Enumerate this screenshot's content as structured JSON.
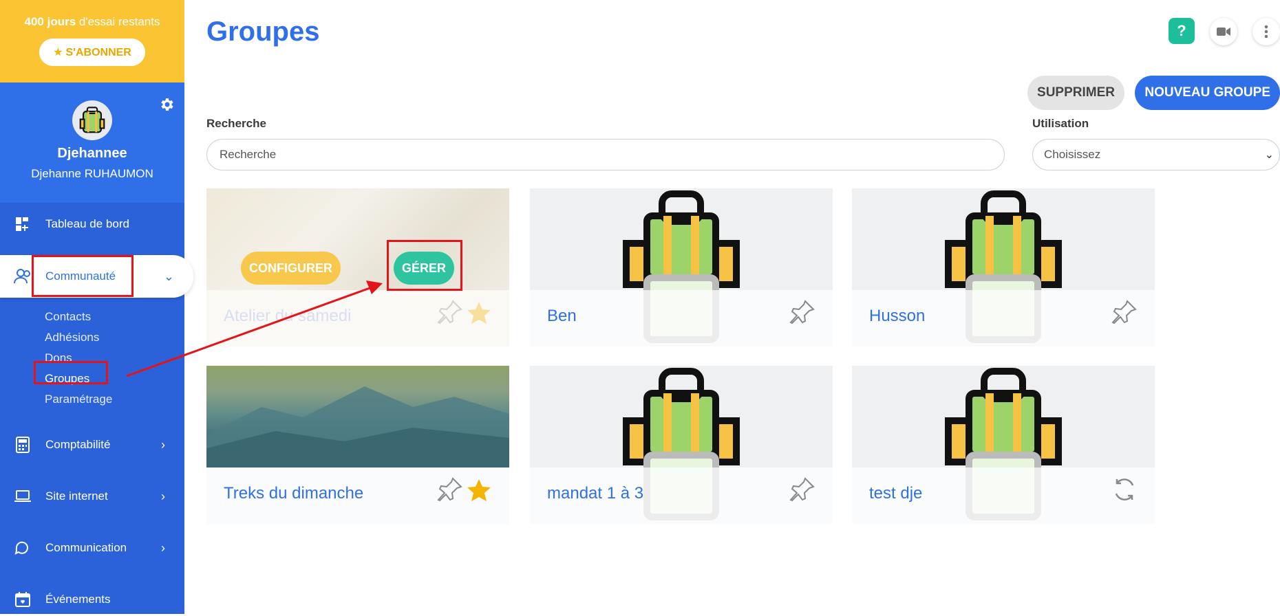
{
  "trial": {
    "days": "400 jours",
    "rest": " d'essai restants",
    "subscribe": "S'ABONNER"
  },
  "profile": {
    "name": "Djehannee",
    "fullname": "Djehanne RUHAUMON"
  },
  "menu": {
    "dashboard": "Tableau de bord",
    "community": "Communauté",
    "accounting": "Comptabilité",
    "website": "Site internet",
    "communication": "Communication",
    "events": "Événements"
  },
  "community_sub": [
    "Contacts",
    "Adhésions",
    "Dons",
    "Groupes",
    "Paramétrage"
  ],
  "page": {
    "title": "Groupes",
    "delete": "SUPPRIMER",
    "new_group": "NOUVEAU GROUPE",
    "search_label": "Recherche",
    "search_placeholder": "Recherche",
    "usage_label": "Utilisation",
    "usage_value": "Choisissez",
    "help": "?"
  },
  "cards": [
    {
      "name": "Atelier du samedi",
      "configure": "CONFIGURER",
      "manage": "GÉRER",
      "favorite": true
    },
    {
      "name": "Ben"
    },
    {
      "name": "Husson"
    },
    {
      "name": "Treks du dimanche",
      "favorite": true
    },
    {
      "name": "mandat 1 à 3"
    },
    {
      "name": "test dje"
    }
  ],
  "colors": {
    "brand_blue": "#2f6fe8",
    "trial_yellow": "#fac433",
    "teal": "#1dbf9b",
    "annotation_red": "#e3141a"
  }
}
